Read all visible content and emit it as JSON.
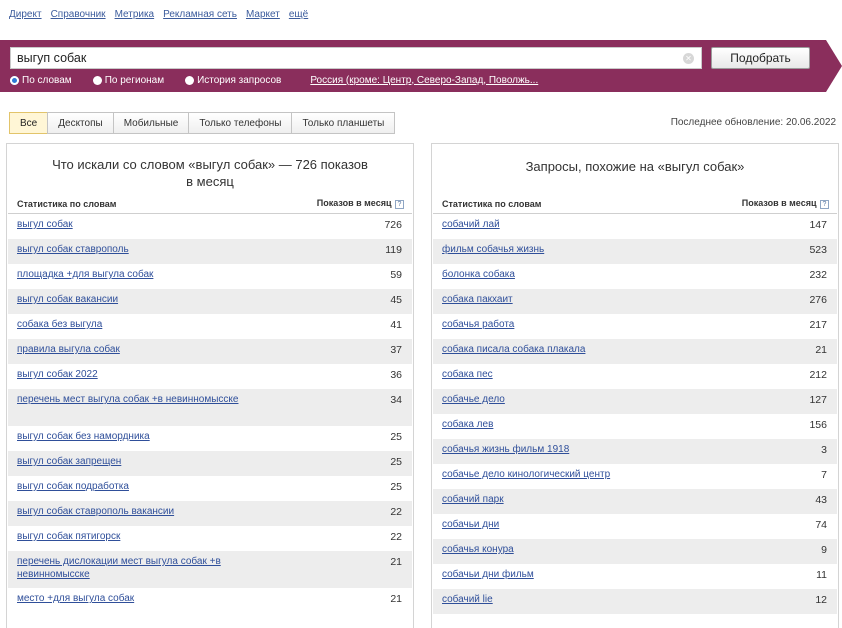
{
  "topnav": [
    "Директ",
    "Справочник",
    "Метрика",
    "Рекламная сеть",
    "Маркет",
    "ещё"
  ],
  "search": {
    "query": "выгуп собак",
    "submit_label": "Подобрать",
    "radios": [
      {
        "label": "По словам",
        "selected": true
      },
      {
        "label": "По регионам",
        "selected": false
      },
      {
        "label": "История запросов",
        "selected": false
      }
    ],
    "region": "Россия (кроме: Центр, Северо-Запад, Поволжь..."
  },
  "tabs": [
    {
      "label": "Все",
      "active": true
    },
    {
      "label": "Десктопы",
      "active": false
    },
    {
      "label": "Мобильные",
      "active": false
    },
    {
      "label": "Только телефоны",
      "active": false
    },
    {
      "label": "Только планшеты",
      "active": false
    }
  ],
  "last_update": "Последнее обновление: 20.06.2022",
  "colors": {
    "accent_band": "#8a2e5c",
    "link": "#2f4f9a",
    "active_tab": "#fff6d6"
  },
  "left_panel": {
    "title": "Что искали со словом «выгул собак» — 726 показов в месяц",
    "col_keyword": "Статистика по словам",
    "col_count": "Показов в месяц",
    "rows": [
      {
        "keyword": "выгул собак",
        "count": "726"
      },
      {
        "keyword": "выгул собак ставрополь",
        "count": "119"
      },
      {
        "keyword": "площадка +для выгула собак",
        "count": "59"
      },
      {
        "keyword": "выгул собак вакансии",
        "count": "45"
      },
      {
        "keyword": "собака без выгула",
        "count": "41"
      },
      {
        "keyword": "правила выгула собак",
        "count": "37"
      },
      {
        "keyword": "выгул собак 2022",
        "count": "36"
      },
      {
        "keyword": "перечень мест выгула собак +в невинномысске",
        "count": "34"
      },
      {
        "keyword": "выгул собак без намордника",
        "count": "25"
      },
      {
        "keyword": "выгул собак запрещен",
        "count": "25"
      },
      {
        "keyword": "выгул собак подработка",
        "count": "25"
      },
      {
        "keyword": "выгул собак ставрополь вакансии",
        "count": "22"
      },
      {
        "keyword": "выгул собак пятигорск",
        "count": "22"
      },
      {
        "keyword": "перечень дислокации мест выгула собак +в невинномысске",
        "count": "21"
      },
      {
        "keyword": "место +для выгула собак",
        "count": "21"
      }
    ]
  },
  "right_panel": {
    "title": "Запросы, похожие на «выгул собак»",
    "col_keyword": "Статистика по словам",
    "col_count": "Показов в месяц",
    "rows": [
      {
        "keyword": "собачий лай",
        "count": "147"
      },
      {
        "keyword": "фильм собачья жизнь",
        "count": "523"
      },
      {
        "keyword": "болонка собака",
        "count": "232"
      },
      {
        "keyword": "собака пакхаит",
        "count": "276"
      },
      {
        "keyword": "собачья работа",
        "count": "217"
      },
      {
        "keyword": "собака писала собака плакала",
        "count": "21"
      },
      {
        "keyword": "собака пес",
        "count": "212"
      },
      {
        "keyword": "собачье дело",
        "count": "127"
      },
      {
        "keyword": "собака лев",
        "count": "156"
      },
      {
        "keyword": "собачья жизнь фильм 1918",
        "count": "3"
      },
      {
        "keyword": "собачье дело кинологический центр",
        "count": "7"
      },
      {
        "keyword": "собачий парк",
        "count": "43"
      },
      {
        "keyword": "собачьи дни",
        "count": "74"
      },
      {
        "keyword": "собачья конура",
        "count": "9"
      },
      {
        "keyword": "собачьи дни фильм",
        "count": "11"
      },
      {
        "keyword": "собачий lie",
        "count": "12"
      }
    ]
  }
}
